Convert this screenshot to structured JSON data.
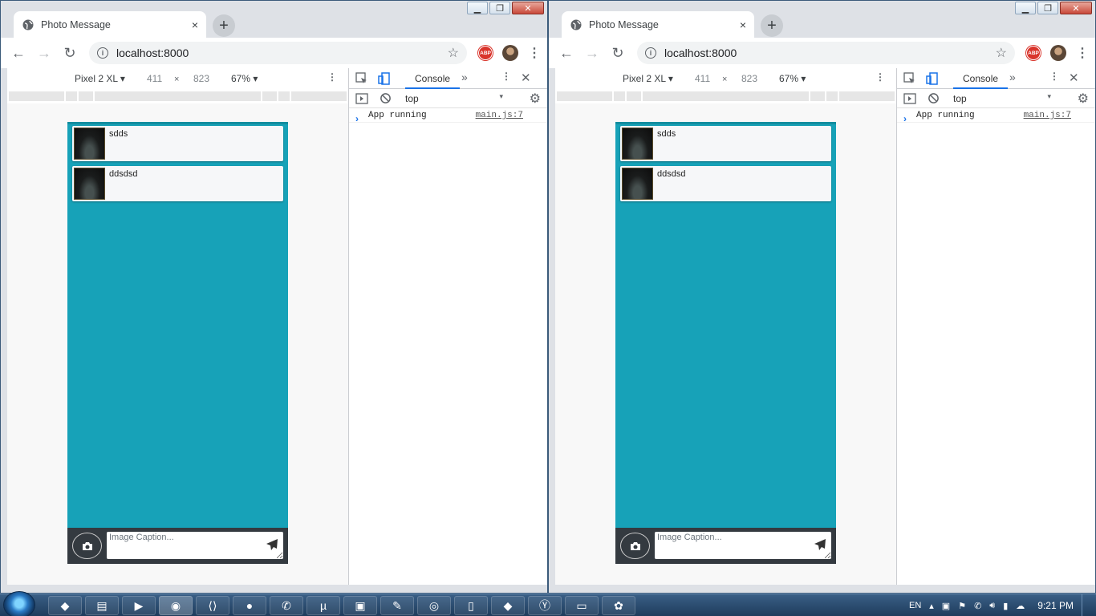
{
  "browser": {
    "tab_title": "Photo Message",
    "new_tab": "+",
    "close_tab": "×",
    "url": "localhost:8000",
    "abp": "ABP"
  },
  "device_toolbar": {
    "device": "Pixel 2 XL ▾",
    "width": "411",
    "times": "×",
    "height": "823",
    "zoom": "67% ▾"
  },
  "app": {
    "messages": [
      {
        "caption": "sdds"
      },
      {
        "caption": "ddsdsd"
      }
    ],
    "caption_placeholder": "Image Caption..."
  },
  "devtools": {
    "tab": "Console",
    "more": "»",
    "context": "top",
    "log_text": "App running",
    "log_source": "main.js:7",
    "prompt": "›"
  },
  "taskbar": {
    "language": "EN",
    "time": "9:21 PM"
  }
}
